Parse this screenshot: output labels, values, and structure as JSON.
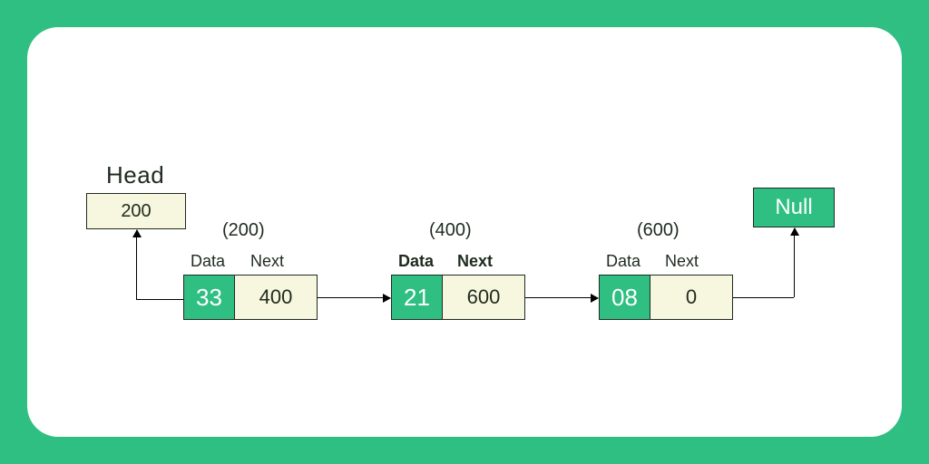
{
  "head": {
    "label": "Head",
    "value": "200"
  },
  "labels": {
    "data": "Data",
    "next": "Next"
  },
  "nodes": [
    {
      "addr": "(200)",
      "data": "33",
      "next": "400",
      "boldLabels": false
    },
    {
      "addr": "(400)",
      "data": "21",
      "next": "600",
      "boldLabels": true
    },
    {
      "addr": "(600)",
      "data": "08",
      "next": "0",
      "boldLabels": false
    }
  ],
  "nullLabel": "Null"
}
